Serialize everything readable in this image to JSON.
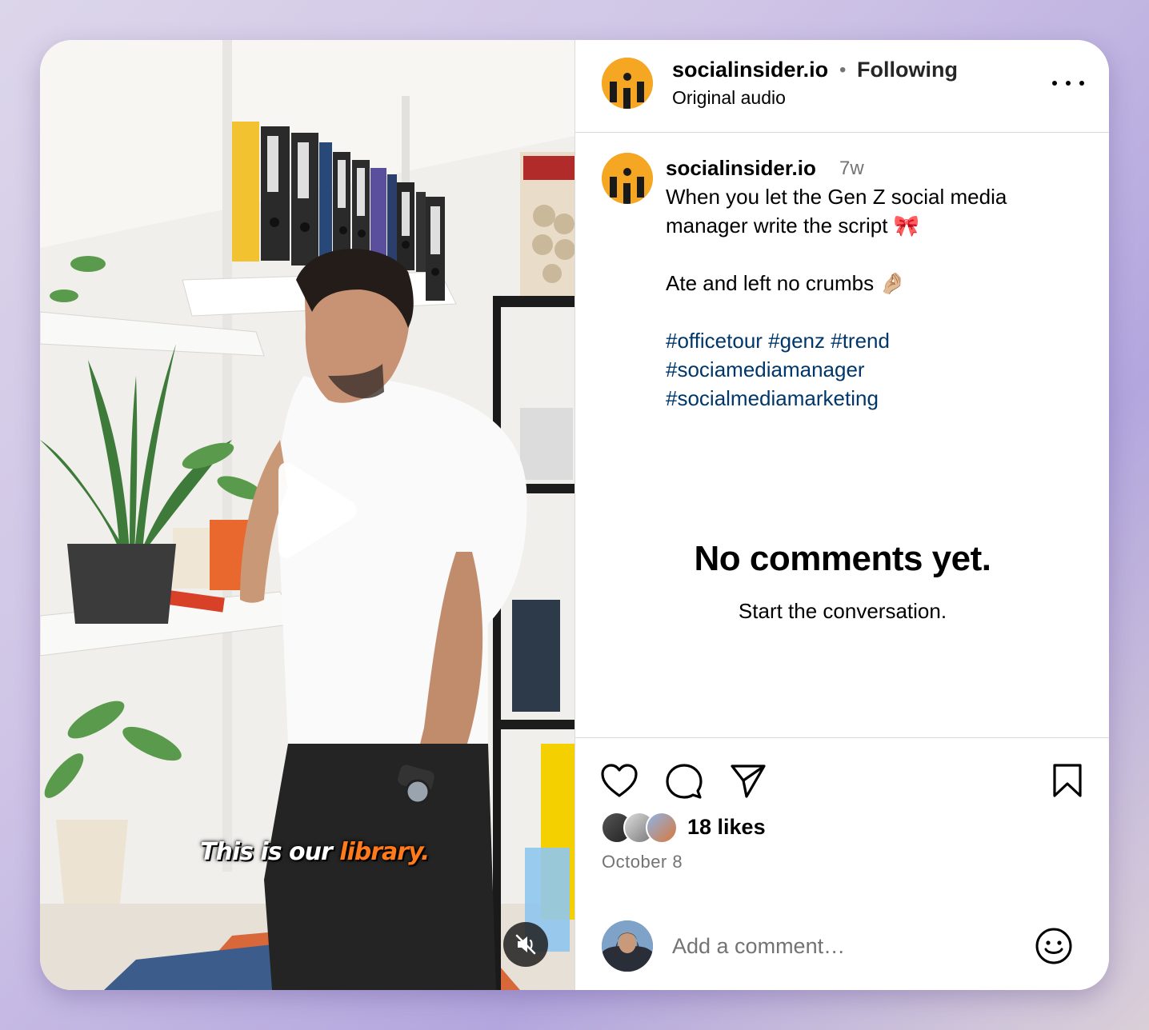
{
  "video": {
    "caption_plain": "This is our ",
    "caption_highlight": "library."
  },
  "header": {
    "username": "socialinsider.io",
    "separator": "•",
    "follow_status": "Following",
    "audio_label": "Original audio"
  },
  "post": {
    "author": "socialinsider.io",
    "age": "7w",
    "caption_line1": "When you let the Gen Z social media",
    "caption_line2": "manager write the script 🎀",
    "caption_line3": "Ate and left no crumbs 🤌🏼",
    "hashtags_row1": [
      "#officetour",
      "#genz",
      "#trend"
    ],
    "hashtags_row2": [
      "#sociamediamanager"
    ],
    "hashtags_row3": [
      "#socialmediamarketing"
    ]
  },
  "comments": {
    "empty_title": "No comments yet.",
    "empty_subtitle": "Start the conversation."
  },
  "actions": {
    "icons": [
      "heart-icon",
      "comment-icon",
      "share-icon",
      "bookmark-icon"
    ],
    "likes_label": "18 likes",
    "date": "October 8",
    "comment_placeholder": "Add a comment…"
  },
  "colors": {
    "brand_avatar": "#f5a623",
    "hashtag": "#00376b",
    "muted_text": "#737373",
    "caption_highlight": "#ff7a1a"
  }
}
